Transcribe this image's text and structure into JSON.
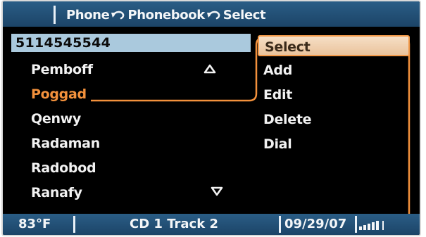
{
  "header": {
    "crumbs": [
      "Phone",
      "Phonebook",
      "Select"
    ],
    "separator_icon": "back-arrow-icon"
  },
  "number_field": {
    "value": "5114545544"
  },
  "contacts": [
    "Pemboff",
    "Poggad",
    "Qenwy",
    "Radaman",
    "Radobod",
    "Ranafy"
  ],
  "selected_contact_index": 1,
  "menu": {
    "items": [
      "Select",
      "Add",
      "Edit",
      "Delete",
      "Dial"
    ],
    "selected_index": 0
  },
  "status": {
    "temperature": "83°F",
    "media": "CD 1 Track 2",
    "date": "09/29/07",
    "signal_level": 5,
    "signal_icon": "signal-strength-icon"
  },
  "colors": {
    "bar_blue": "#1f4d74",
    "highlight_orange": "#f3913c",
    "number_bg": "#aac9dd"
  }
}
